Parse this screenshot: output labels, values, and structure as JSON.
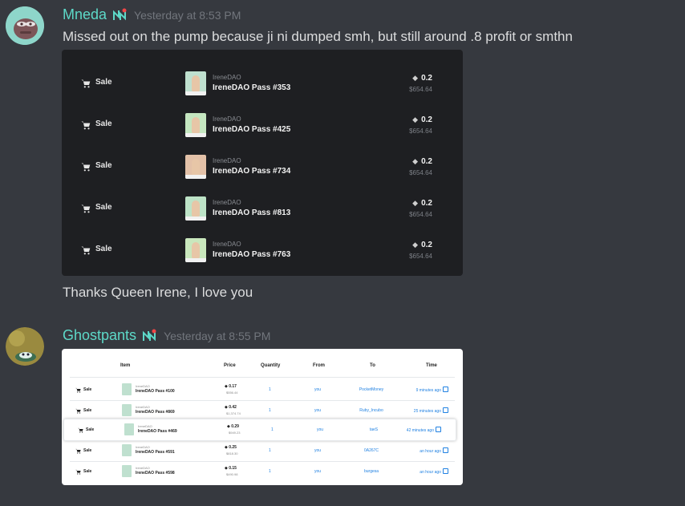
{
  "messages": [
    {
      "username": "Mneda",
      "timestamp": "Yesterday at 8:53 PM",
      "text": "Missed out on the pump because ji ni dumped smh, but still around .8 profit or smthn",
      "after_text": "Thanks Queen Irene, I love you"
    },
    {
      "username": "Ghostpants",
      "timestamp": "Yesterday at 8:55 PM"
    }
  ],
  "dark_embed": {
    "rows": [
      {
        "event": "Sale",
        "collection": "IreneDAO",
        "name": "IreneDAO Pass #353",
        "price": "0.2",
        "usd": "$654.64"
      },
      {
        "event": "Sale",
        "collection": "IreneDAO",
        "name": "IreneDAO Pass #425",
        "price": "0.2",
        "usd": "$654.64"
      },
      {
        "event": "Sale",
        "collection": "IreneDAO",
        "name": "IreneDAO Pass #734",
        "price": "0.2",
        "usd": "$654.64"
      },
      {
        "event": "Sale",
        "collection": "IreneDAO",
        "name": "IreneDAO Pass #813",
        "price": "0.2",
        "usd": "$654.64"
      },
      {
        "event": "Sale",
        "collection": "IreneDAO",
        "name": "IreneDAO Pass #763",
        "price": "0.2",
        "usd": "$654.64"
      }
    ]
  },
  "light_embed": {
    "headers": {
      "item": "Item",
      "price": "Price",
      "quantity": "Quantity",
      "from": "From",
      "to": "To",
      "time": "Time"
    },
    "rows": [
      {
        "event": "Sale",
        "collection": "IreneDAO",
        "name": "IreneDAO Pass #100",
        "price": "0.17",
        "usd": "$556.44",
        "quantity": "1",
        "from": "you",
        "to": "PocketMoney",
        "time": "9 minutes ago"
      },
      {
        "event": "Sale",
        "collection": "IreneDAO",
        "name": "IreneDAO Pass #869",
        "price": "0.42",
        "usd": "$1,374.74",
        "quantity": "1",
        "from": "you",
        "to": "Ruby_Incubo",
        "time": "25 minutes ago"
      },
      {
        "event": "Sale",
        "collection": "IreneDAO",
        "name": "IreneDAO Pass #469",
        "price": "0.29",
        "usd": "$949.23",
        "quantity": "1",
        "from": "you",
        "to": "taeS",
        "time": "42 minutes ago"
      },
      {
        "event": "Sale",
        "collection": "IreneDAO",
        "name": "IreneDAO Pass #591",
        "price": "0.25",
        "usd": "$818.30",
        "quantity": "1",
        "from": "you",
        "to": "0A267C",
        "time": "an hour ago"
      },
      {
        "event": "Sale",
        "collection": "IreneDAO",
        "name": "IreneDAO Pass #598",
        "price": "0.15",
        "usd": "$490.98",
        "quantity": "1",
        "from": "you",
        "to": "burgesa",
        "time": "an hour ago"
      }
    ]
  },
  "colors": {
    "background": "#36393f",
    "username": "#5dd9c8",
    "timestamp": "#72767d",
    "link": "#2081e2"
  },
  "icons": [
    "nft-badge-icon",
    "cart-icon",
    "eth-icon",
    "external-link-icon"
  ]
}
